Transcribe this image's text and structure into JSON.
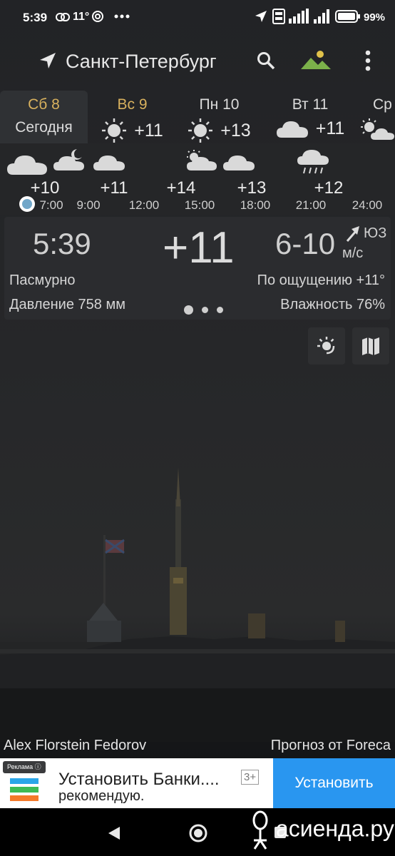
{
  "status_bar": {
    "time": "5:39",
    "temp": "11°",
    "battery": "99%"
  },
  "header": {
    "city": "Санкт-Петербург"
  },
  "days": [
    {
      "name": "Сб 8",
      "sub": "Сегодня",
      "icon": "cloud-icon",
      "temp": "",
      "selected": true
    },
    {
      "name": "Вс 9",
      "sub": "",
      "icon": "sun-icon",
      "temp": "+11"
    },
    {
      "name": "Пн 10",
      "sub": "",
      "icon": "sun-icon",
      "temp": "+13"
    },
    {
      "name": "Вт 11",
      "sub": "",
      "icon": "cloud-icon",
      "temp": "+11"
    },
    {
      "name": "Ср",
      "sub": "",
      "icon": "sun-cloud-icon",
      "temp": ""
    }
  ],
  "hourly": {
    "temps": [
      "+10",
      "+11",
      "+14",
      "+13",
      "+12"
    ],
    "times": [
      "7:00",
      "9:00",
      "12:00",
      "15:00",
      "18:00",
      "21:00",
      "24:00"
    ]
  },
  "current": {
    "time": "5:39",
    "temp": "+11",
    "wind_speed": "6-10",
    "wind_dir": "ЮЗ",
    "wind_unit": "м/с",
    "condition": "Пасмурно",
    "feels_like": "По ощущению +11°",
    "pressure": "Давление 758 мм",
    "humidity": "Влажность 76%"
  },
  "credits": {
    "photo_author": "Alex Florstein Fedorov",
    "forecast_source": "Прогноз от Foreca"
  },
  "ad": {
    "badge": "Реклама",
    "title": "Установить Банки....",
    "subtitle": "рекомендую.",
    "age_rating": "3+",
    "install_label": "Установить"
  },
  "watermark": {
    "text": "асиенда.ру"
  },
  "colors": {
    "accent_gold": "#d8b15e",
    "ad_button": "#2996f0",
    "now_marker": "#72a7c9"
  }
}
